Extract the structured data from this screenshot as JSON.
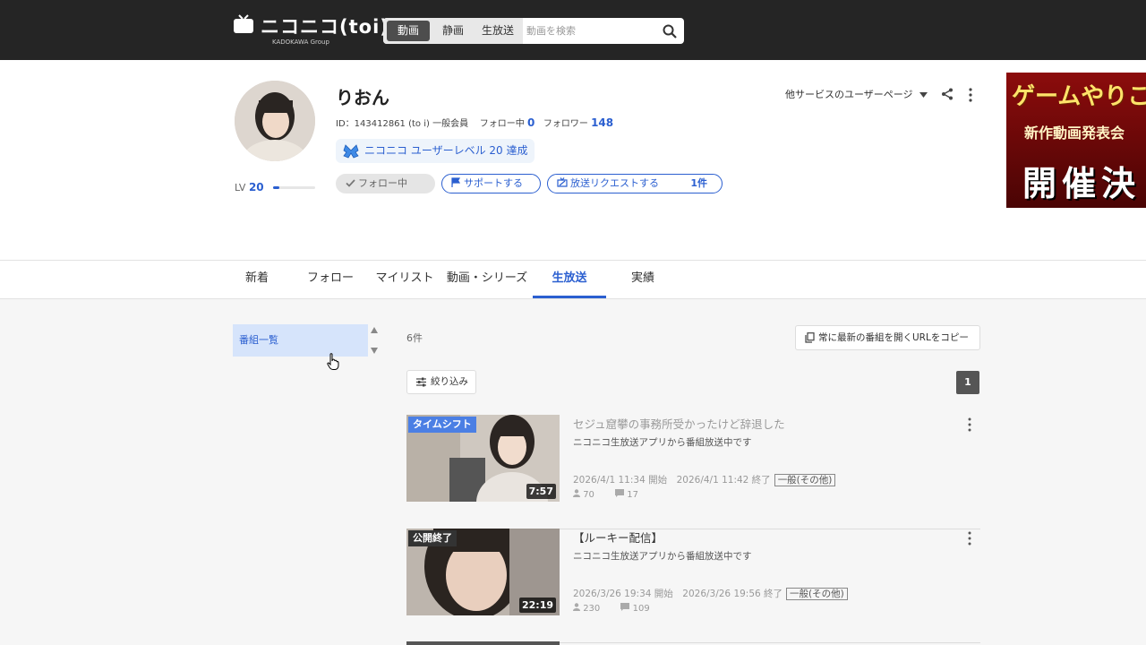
{
  "header": {
    "brand": "ニコニコ(toi)",
    "group": "KADOKAWA Group",
    "search_tabs": [
      "動画",
      "静画",
      "生放送"
    ],
    "search_placeholder": "動画を検索"
  },
  "profile": {
    "name": "りおん",
    "id_label": "ID：143412861 (to i) 一般会員",
    "following_label": "フォロー中",
    "following_count": "0",
    "followers_label": "フォロワー",
    "followers_count": "148",
    "level_badge": "ニコニコ ユーザーレベル 20 達成",
    "lv_label": "LV",
    "lv_value": "20",
    "lv_progress": 0.15,
    "follow_button": "フォロー中",
    "support_button": "サポートする",
    "request_button": "放送リクエストする",
    "request_count": "1件",
    "other_services": "他サービスのユーザーページ"
  },
  "ad": {
    "line1": "ゲームやりこ",
    "line2": "新作動画発表会",
    "line3": "開催決"
  },
  "tabs": [
    "新着",
    "フォロー",
    "マイリスト",
    "動画・シリーズ",
    "生放送",
    "実績"
  ],
  "active_tab": "生放送",
  "sidebar": {
    "item": "番組一覧"
  },
  "list": {
    "count": "6件",
    "copy_button": "常に最新の番組を開くURLをコピー",
    "filter_button": "絞り込み",
    "page": "1",
    "items": [
      {
        "label": "タイムシフト",
        "duration": "7:57",
        "title": "セジュ窟攀の事務所受かったけど辞退した",
        "desc": "ニコニコ生放送アプリから番組放送中です",
        "dates": "2026/4/1 11:34 開始　2026/4/1 11:42 終了",
        "category": "一般(その他)",
        "viewers": "70",
        "comments": "17"
      },
      {
        "label": "公開終了",
        "duration": "22:19",
        "title": "【ルーキー配信】",
        "desc": "ニコニコ生放送アプリから番組放送中です",
        "dates": "2026/3/26 19:34 開始　2026/3/26 19:56 終了",
        "category": "一般(その他)",
        "viewers": "230",
        "comments": "109"
      }
    ]
  },
  "colors": {
    "accent": "#2b5fd0",
    "topbar": "#252525",
    "timeshift": "#4b7fe4"
  }
}
